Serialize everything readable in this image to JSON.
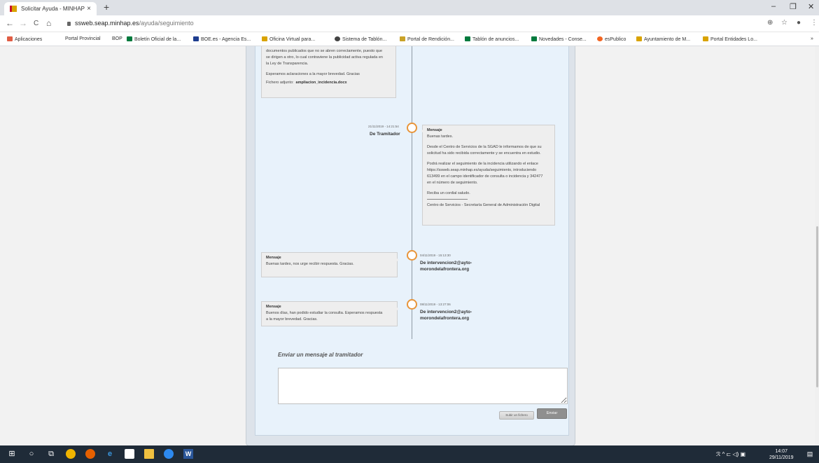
{
  "browser": {
    "tab_title": "Solicitar Ayuda - MINHAP",
    "tab_close": "×",
    "new_tab": "+",
    "url_host": "ssweb.seap.minhap.es",
    "url_path": "/ayuda/seguimiento",
    "window_controls": [
      "–",
      "❐",
      "✕"
    ],
    "nav": [
      "←",
      "→",
      "C",
      "⌂"
    ],
    "addr_icons": [
      "⊕",
      "☆",
      "●",
      "⋮"
    ]
  },
  "bookmarks": [
    {
      "label": "Aplicaciones",
      "color": "#e05d44"
    },
    {
      "label": "Portal Provincial",
      "color": ""
    },
    {
      "label": "BOP",
      "color": ""
    },
    {
      "label": "Boletín Oficial de la...",
      "color": "#007a3d"
    },
    {
      "label": "BOE.es - Agencia Es...",
      "color": "#1e3d8f"
    },
    {
      "label": "Oficina Virtual para...",
      "color": "#d9a300"
    },
    {
      "label": "Sistema de Tablón...",
      "color": "#444444"
    },
    {
      "label": "Portal de Rendición...",
      "color": "#c9a227"
    },
    {
      "label": "Tablón de anuncios...",
      "color": "#007a3d"
    },
    {
      "label": "Novedades - Conse...",
      "color": "#007a3d"
    },
    {
      "label": "esPublico",
      "color": "#f26522"
    },
    {
      "label": "Ayuntamiento de M...",
      "color": "#d9a300"
    },
    {
      "label": "Portal Entidades Lo...",
      "color": "#d9a300"
    }
  ],
  "bookmarks_more": "»",
  "timeline": {
    "first_bubble_lines": [
      "documentos publicados que no se abren correctamente, puesto que",
      "se dirigen a otro, lo cual contraviene la publicidad activa regulada en",
      "la Ley de Transparencia.",
      "",
      "Esperamos aclaraciones a la mayor brevedad. Gracias",
      ""
    ],
    "attachment_label": "Fichero adjunto:",
    "attachment_name": "ampliacion_incidencia.docx",
    "entries": [
      {
        "date": "21/11/2019 - 14:21:54",
        "from": "De Tramitador",
        "title": "Mensaje",
        "lines": [
          "Buenas tardes.",
          "",
          "Desde el Centro de Servicios de la SGAD le informamos de que su",
          "solicitud ha sido recibida correctamente y se encuentra en estudio.",
          "",
          "Podrá realizar el seguimiento de la incidencia utilizando el enlace",
          "https://ssweb.seap.minhap.es/ayuda/seguimiento, introduciendo",
          "613499 en el campo identificador de consulta o incidencia y 342477",
          "en el número de seguimiento.",
          "",
          "Reciba un cordial saludo."
        ],
        "signature": "Centro de Servicios - Secretaría General de Administración Digital"
      },
      {
        "date": "04/11/2019 - 15:13:30",
        "from_line1": "De intervencion2@ayto-",
        "from_line2": "morondelafrontera.org",
        "title": "Mensaje",
        "lines": [
          "Buenas tardes, nos urge recibir respuesta. Gracias."
        ]
      },
      {
        "date": "08/11/2019 - 13:27:06",
        "from_line1": "De intervencion2@ayto-",
        "from_line2": "morondelafrontera.org",
        "title": "Mensaje",
        "lines": [
          "Buenos días, han podido estudiar la consulta. Esperamos respuesta",
          "a la mayor brevedad. Gracias."
        ]
      }
    ]
  },
  "form": {
    "title": "Enviar un mensaje al tramitador",
    "message_value": "",
    "file_button": "Subir un fichero",
    "send_button": "Enviar"
  },
  "taskbar": {
    "tray_symbols": "ℛ  ^  ⊏  ◁)  ▣",
    "time": "14:07",
    "date": "29/11/2019"
  },
  "colors": {
    "timeline_circle": "#e8953a",
    "panel_bg": "#e8f2fb",
    "taskbar_bg": "#1f2b38"
  }
}
